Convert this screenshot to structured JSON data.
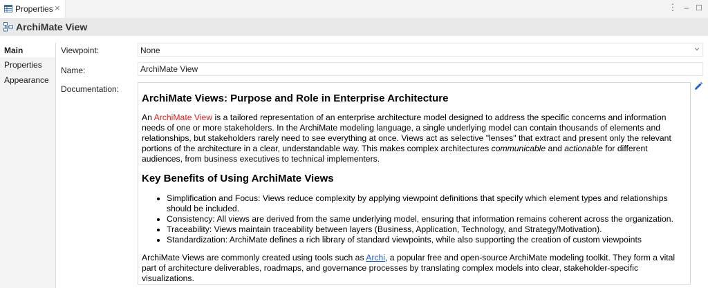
{
  "tab": {
    "title": "Properties",
    "close": "×"
  },
  "window_controls": {
    "menu": "⋮",
    "minimize": "–",
    "maximize": "☐"
  },
  "header": {
    "title": "ArchiMate View"
  },
  "sidetabs": [
    {
      "label": "Main",
      "active": true
    },
    {
      "label": "Properties",
      "active": false
    },
    {
      "label": "Appearance",
      "active": false
    }
  ],
  "form": {
    "viewpoint_label": "Viewpoint:",
    "viewpoint_value": "None",
    "name_label": "Name:",
    "name_value": "ArchiMate View",
    "documentation_label": "Documentation:"
  },
  "documentation": {
    "heading1": "ArchiMate Views: Purpose and Role in Enterprise Architecture",
    "p1": {
      "lead": "An ",
      "highlight": "ArchiMate View",
      "text_a": " is a tailored representation of an enterprise architecture model designed to address the specific concerns and information needs of one or more stakeholders. In the ArchiMate modeling language, a single underlying model can contain thousands of elements and relationships, but stakeholders rarely need to see everything at once. Views act as selective \"lenses\" that extract and present only the relevant portions of the architecture in a clear, understandable way. This makes complex architectures ",
      "em1": "communicable",
      "and": " and ",
      "em2": "actionable",
      "text_b": " for different audiences, from business executives to technical implementers."
    },
    "heading2": "Key Benefits of Using ArchiMate Views",
    "bullets": [
      "Simplification and Focus: Views reduce complexity by applying viewpoint definitions that specify which element types and relationships should be included.",
      "Consistency: All views are derived from the same underlying model, ensuring that information remains coherent across the organization.",
      "Traceability: Views maintain traceability between layers (Business, Application, Technology, and Strategy/Motivation).",
      "Standardization: ArchiMate defines a rich library of standard viewpoints, while also supporting the creation of custom viewpoints"
    ],
    "p2": {
      "lead": "ArchiMate Views are commonly created using tools such as ",
      "link": "Archi",
      "text": ", a popular free and open-source ArchiMate modeling toolkit. They form a vital part of architecture deliverables, roadmaps, and governance processes by translating complex models into clear, stakeholder-specific visualizations."
    }
  },
  "colors": {
    "accent": "#1a5fd6",
    "highlight_red": "#e01b1b",
    "header_bg": "#e9e9e9"
  },
  "icons": {
    "tab": "properties-table-icon",
    "header": "archimate-view-icon",
    "edit": "pencil-icon",
    "dropdown": "chevron-down-icon"
  }
}
